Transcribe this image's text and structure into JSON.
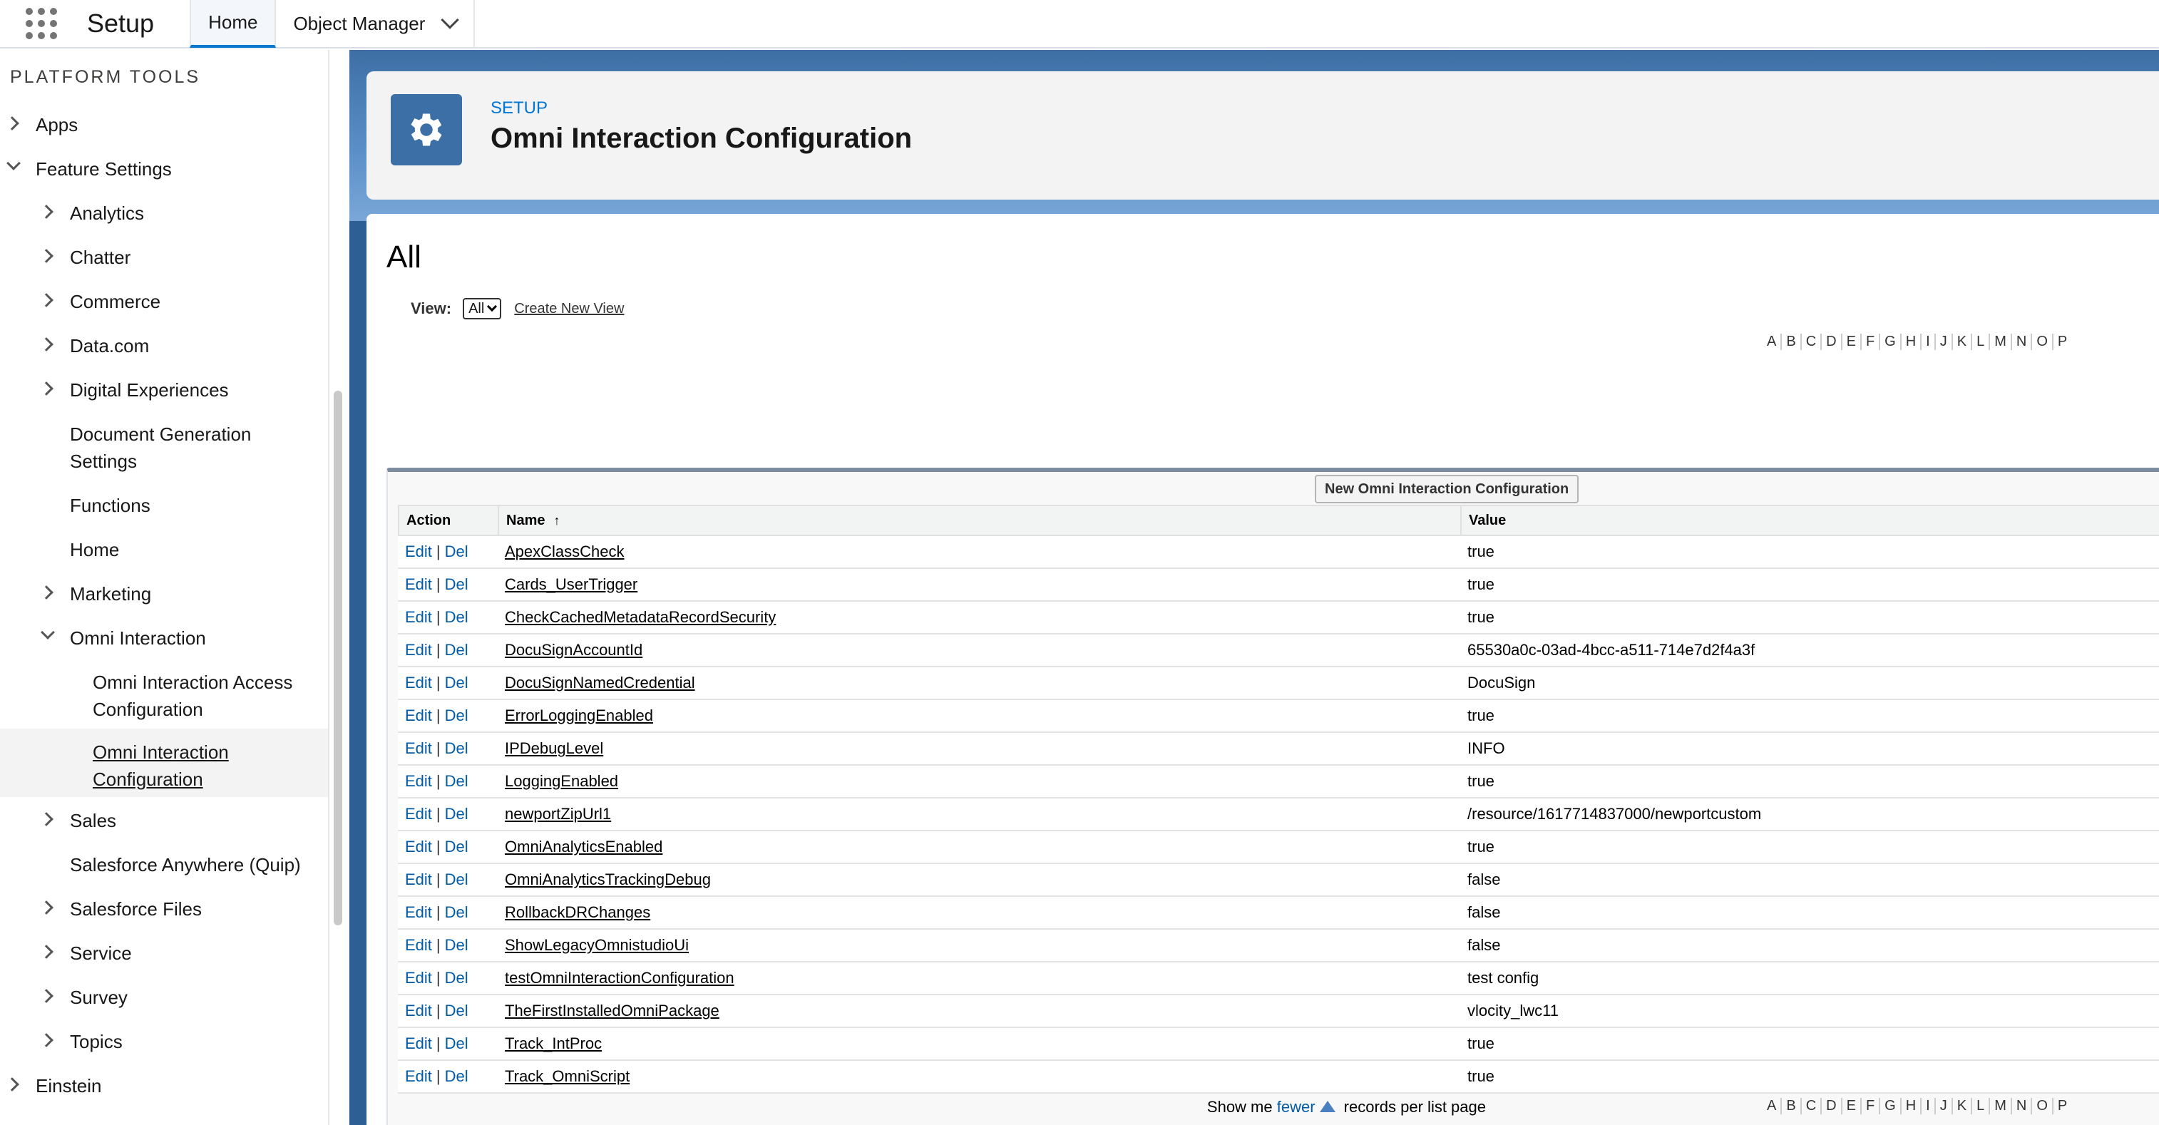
{
  "header": {
    "app_title": "Setup",
    "tabs": [
      {
        "label": "Home"
      },
      {
        "label": "Object Manager"
      }
    ]
  },
  "sidebar": {
    "heading": "PLATFORM TOOLS",
    "items": [
      {
        "label": "Apps"
      },
      {
        "label": "Feature Settings"
      },
      {
        "label": "Analytics"
      },
      {
        "label": "Chatter"
      },
      {
        "label": "Commerce"
      },
      {
        "label": "Data.com"
      },
      {
        "label": "Digital Experiences"
      },
      {
        "label": "Document Generation Settings"
      },
      {
        "label": "Functions"
      },
      {
        "label": "Home"
      },
      {
        "label": "Marketing"
      },
      {
        "label": "Omni Interaction"
      },
      {
        "label": "Omni Interaction Access Configuration"
      },
      {
        "label": "Omni Interaction Configuration"
      },
      {
        "label": "Sales"
      },
      {
        "label": "Salesforce Anywhere (Quip)"
      },
      {
        "label": "Salesforce Files"
      },
      {
        "label": "Service"
      },
      {
        "label": "Survey"
      },
      {
        "label": "Topics"
      },
      {
        "label": "Einstein"
      }
    ]
  },
  "page": {
    "setup_label": "SETUP",
    "title": "Omni Interaction Configuration",
    "view_title": "All",
    "view_label": "View:",
    "view_selected": "All",
    "create_view": "Create New View",
    "new_button": "New Omni Interaction Configuration",
    "alphabet": [
      "A",
      "B",
      "C",
      "D",
      "E",
      "F",
      "G",
      "H",
      "I",
      "J",
      "K",
      "L",
      "M",
      "N",
      "O",
      "P"
    ],
    "columns": {
      "action": "Action",
      "name": "Name",
      "value": "Value",
      "sort_glyph": "↑"
    },
    "action_edit": "Edit",
    "action_sep": "|",
    "action_del": "Del",
    "rows": [
      {
        "name": "ApexClassCheck",
        "value": "true"
      },
      {
        "name": "Cards_UserTrigger",
        "value": "true"
      },
      {
        "name": "CheckCachedMetadataRecordSecurity",
        "value": "true"
      },
      {
        "name": "DocuSignAccountId",
        "value": "65530a0c-03ad-4bcc-a511-714e7d2f4a3f"
      },
      {
        "name": "DocuSignNamedCredential",
        "value": "DocuSign"
      },
      {
        "name": "ErrorLoggingEnabled",
        "value": "true"
      },
      {
        "name": "IPDebugLevel",
        "value": "INFO"
      },
      {
        "name": "LoggingEnabled",
        "value": "true"
      },
      {
        "name": "newportZipUrl1",
        "value": "/resource/1617714837000/newportcustom"
      },
      {
        "name": "OmniAnalyticsEnabled",
        "value": "true"
      },
      {
        "name": "OmniAnalyticsTrackingDebug",
        "value": "false"
      },
      {
        "name": "RollbackDRChanges",
        "value": "false"
      },
      {
        "name": "ShowLegacyOmnistudioUi",
        "value": "false"
      },
      {
        "name": "testOmniInteractionConfiguration",
        "value": "test config"
      },
      {
        "name": "TheFirstInstalledOmniPackage",
        "value": "vlocity_lwc11"
      },
      {
        "name": "Track_IntProc",
        "value": "true"
      },
      {
        "name": "Track_OmniScript",
        "value": "true"
      }
    ],
    "footer": {
      "prefix": "Show me",
      "link": "fewer",
      "suffix": "records per list page"
    }
  }
}
